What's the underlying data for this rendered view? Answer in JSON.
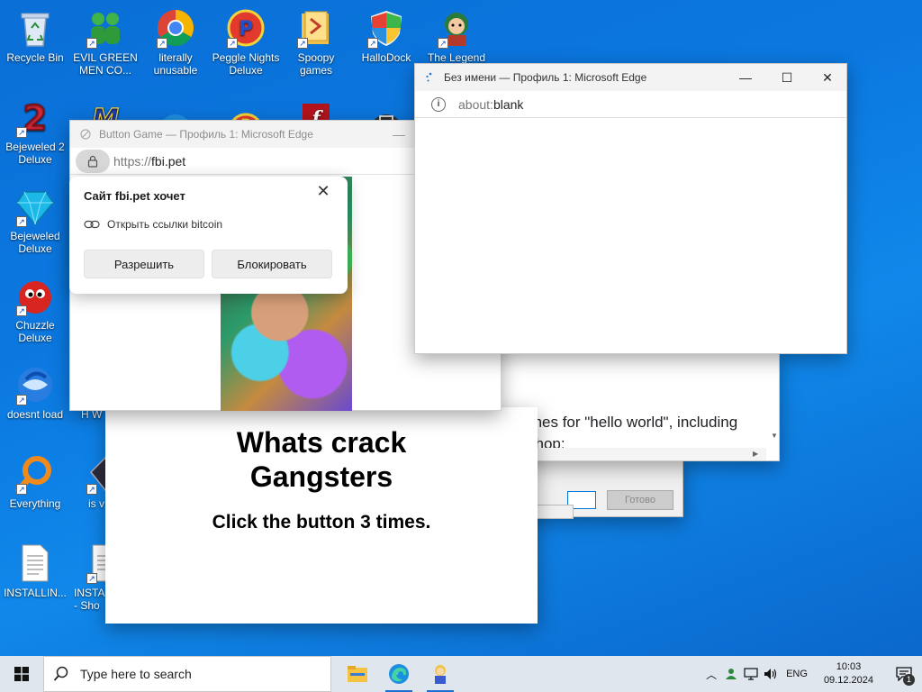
{
  "desktop": {
    "icons": [
      {
        "id": "recycle-bin",
        "label": "Recycle Bin"
      },
      {
        "id": "evil-green",
        "label": "EVIL GREEN MEN CO..."
      },
      {
        "id": "literally-unusable",
        "label": "literally unusable"
      },
      {
        "id": "peggle",
        "label": "Peggle Nights Deluxe"
      },
      {
        "id": "spoopy",
        "label": "Spoopy games"
      },
      {
        "id": "hallodock",
        "label": "HalloDock"
      },
      {
        "id": "the-legend",
        "label": "The Legend"
      },
      {
        "id": "bejeweled2",
        "label": "Bejeweled 2 Deluxe"
      },
      {
        "id": "bejeweled",
        "label": "Bejeweled Deluxe"
      },
      {
        "id": "chuzzle",
        "label": "Chuzzle Deluxe"
      },
      {
        "id": "doesnt-load",
        "label": "doesnt load"
      },
      {
        "id": "everything",
        "label": "Everything"
      },
      {
        "id": "installing",
        "label": "INSTALLIN..."
      },
      {
        "id": "installing2",
        "label": "INSTA - Sho"
      },
      {
        "id": "partial-hw",
        "label": "H W"
      },
      {
        "id": "partial-is",
        "label": "is v"
      }
    ]
  },
  "windows": {
    "edge_blank": {
      "title": "Без имени — Профиль 1: Microsoft Edge",
      "url_proto": "about:",
      "url_host": "blank",
      "controls": {
        "minimize": "—",
        "maximize": "☐",
        "close": "✕"
      }
    },
    "edge_game": {
      "title": "Button Game — Профиль 1: Microsoft Edge",
      "url_proto": "https://",
      "url_host": "fbi.pet",
      "minimize": "—"
    },
    "permission_popup": {
      "title": "Сайт fbi.pet хочет",
      "permission": "Открыть ссылки bitcoin",
      "allow_label": "Разрешить",
      "block_label": "Блокировать",
      "close": "✕"
    },
    "game_page": {
      "headline_line1": "Whats crack",
      "headline_line2": "Gangsters",
      "instruction": "Click the button 3 times."
    },
    "search_window": {
      "result_text": "There are multiple matches for \"hello world\", including 2019 movie, and a gift shop:"
    },
    "dialog_back": {
      "button_label": "Готово"
    }
  },
  "taskbar": {
    "search_placeholder": "Type here to search",
    "language": "ENG",
    "time": "10:03",
    "date": "09.12.2024",
    "notification_count": "1"
  },
  "colors": {
    "desktop_bg": "#0b78e0",
    "taskbar_bg": "#dfe6ee",
    "accent": "#0078d7"
  }
}
